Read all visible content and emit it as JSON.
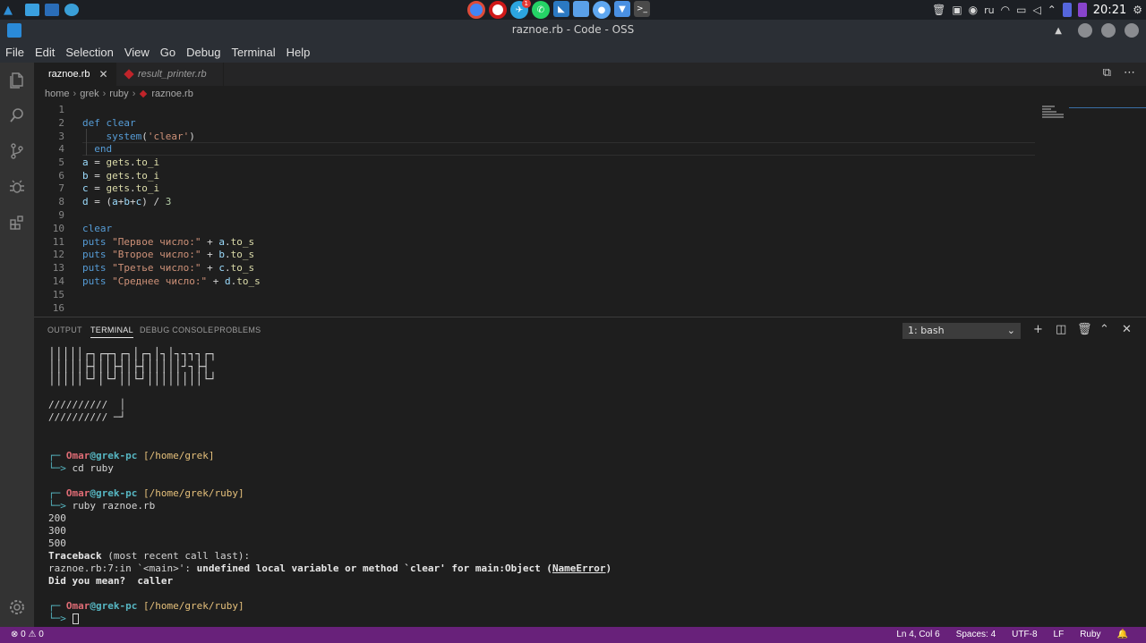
{
  "system": {
    "clock": "20:21",
    "language": "ru",
    "telegram_badge": "1"
  },
  "window": {
    "title": "raznoe.rb - Code - OSS"
  },
  "menu": [
    "File",
    "Edit",
    "Selection",
    "View",
    "Go",
    "Debug",
    "Terminal",
    "Help"
  ],
  "tabs": [
    {
      "label": "raznoe.rb",
      "active": true
    },
    {
      "label": "result_printer.rb",
      "active": false
    }
  ],
  "breadcrumb": [
    "home",
    "grek",
    "ruby",
    "raznoe.rb"
  ],
  "editor": {
    "line_numbers": [
      "1",
      "2",
      "3",
      "4",
      "5",
      "6",
      "7",
      "8",
      "9",
      "10",
      "11",
      "12",
      "13",
      "14",
      "15",
      "16"
    ],
    "lines": [
      "",
      "def clear",
      "    system('clear')",
      "  end",
      "a = gets.to_i",
      "b = gets.to_i",
      "c = gets.to_i",
      "d = (a+b+c) / 3",
      "",
      "clear",
      "puts \"Первое число:\" + a.to_s",
      "puts \"Второе число:\" + b.to_s",
      "puts \"Третье число:\" + c.to_s",
      "puts \"Среднее число:\" + d.to_s",
      "",
      ""
    ]
  },
  "panel": {
    "tabs": [
      "OUTPUT",
      "TERMINAL",
      "DEBUG CONSOLE",
      "PROBLEMS"
    ],
    "active_tab": "TERMINAL",
    "terminal_select": "1: bash"
  },
  "terminal": {
    "ascii_art": [
      "│││││┌┐┌┬┐┌┐│┌┐│┐│┐┐┐┐┌┐",
      "│││││├┤││├┤│├┤│││││┘┐├┤",
      "│││││└┘│└┘││└┘││││││││└┘",
      "//////////  │",
      "////////// ─┘"
    ],
    "user": "Omar",
    "at_host": "@grek-pc",
    "prompt1_path": "[/home/grek]",
    "cmd1": "cd ruby",
    "prompt2_path": "[/home/grek/ruby]",
    "cmd2": "ruby raznoe.rb",
    "out1": "200",
    "out2": "300",
    "out3": "500",
    "traceback_bold": "Traceback",
    "traceback_rest": " (most recent call last):",
    "error_loc": "raznoe.rb:7:in `<main>': ",
    "error_msg": "undefined local variable or method `clear' for main:Object (",
    "error_name": "NameError",
    "error_close": ")",
    "did_you_mean": "Did you mean?  caller",
    "prompt3_path": "[/home/grek/ruby]"
  },
  "statusbar": {
    "errors": "0",
    "warnings": "0",
    "position": "Ln 4, Col 6",
    "spaces": "Spaces: 4",
    "encoding": "UTF-8",
    "eol": "LF",
    "language": "Ruby"
  },
  "colors": {
    "statusbar": "#68217a",
    "keyword": "#569cd6",
    "string": "#ce9178",
    "prompt_user": "#e06c75",
    "prompt_path": "#e5c07b"
  }
}
